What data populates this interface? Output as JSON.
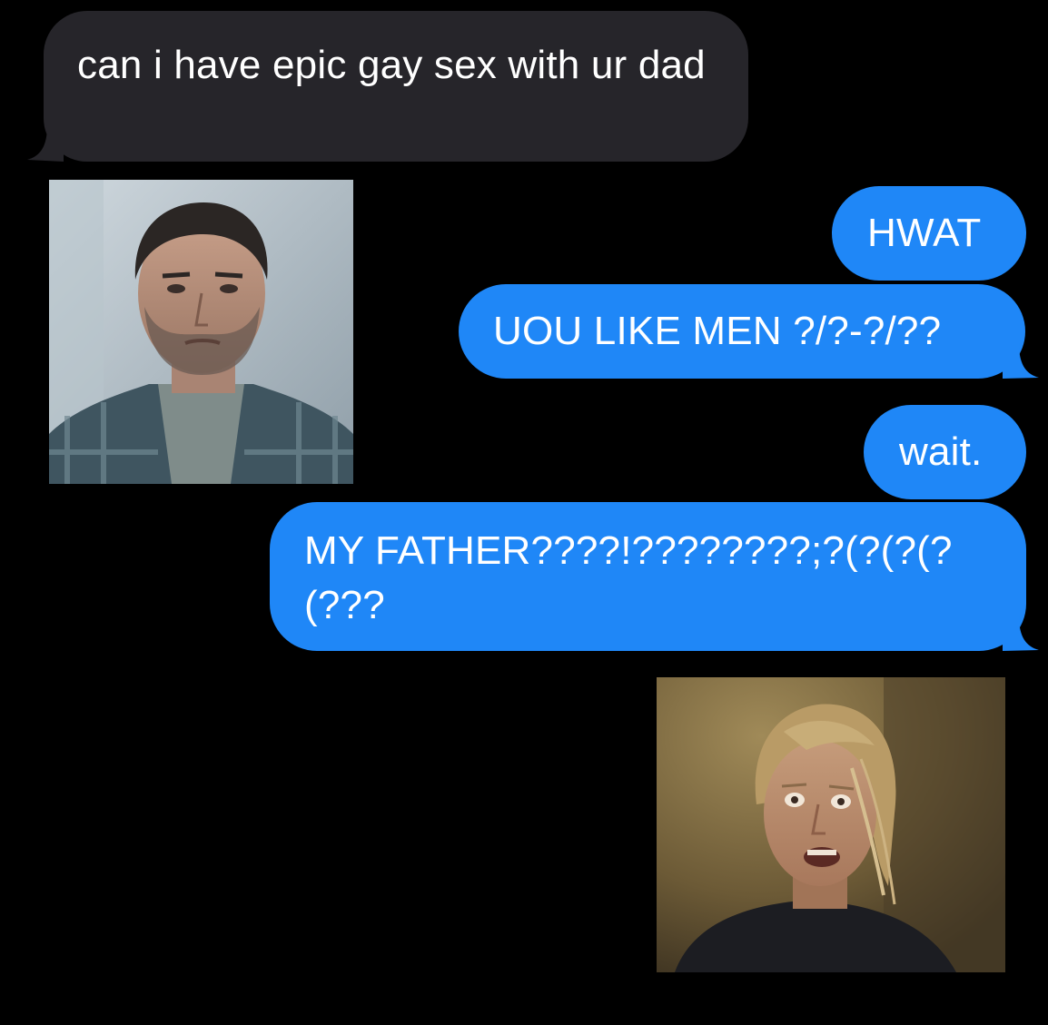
{
  "conversation": {
    "colors": {
      "background": "#000000",
      "incoming_bubble": "#26252a",
      "outgoing_bubble": "#1f87f7",
      "text": "#ffffff"
    },
    "messages": [
      {
        "from": "them",
        "kind": "text",
        "text": "can i have epic gay sex with ur dad"
      },
      {
        "from": "them",
        "kind": "image",
        "icon": "photo-man-plaid-shirt"
      },
      {
        "from": "me",
        "kind": "text",
        "text": "HWAT"
      },
      {
        "from": "me",
        "kind": "text",
        "text": "UOU LIKE MEN ?/?-?/??"
      },
      {
        "from": "me",
        "kind": "text",
        "text": "wait."
      },
      {
        "from": "me",
        "kind": "text",
        "text": "MY FATHER????!????????;?(?(?(?(???"
      },
      {
        "from": "me",
        "kind": "image",
        "icon": "photo-shocked-woman"
      }
    ]
  }
}
